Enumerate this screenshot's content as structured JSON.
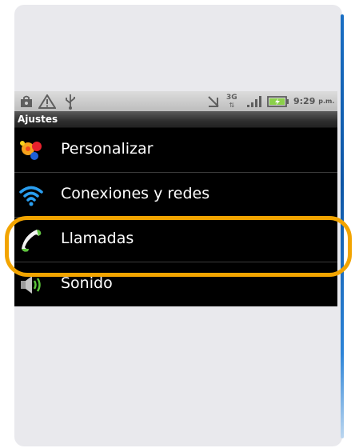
{
  "statusbar": {
    "network_type": "3G",
    "time": "9:29",
    "time_suffix": "p.m.",
    "left_icons": [
      "store-icon",
      "warning-icon",
      "usb-icon"
    ],
    "right_icons": [
      "no-signal-icon",
      "3g-icon",
      "signal-bars-icon",
      "battery-charging-icon"
    ]
  },
  "screen": {
    "title": "Ajustes"
  },
  "settings": {
    "items": [
      {
        "label": "Personalizar",
        "icon": "personalize-icon"
      },
      {
        "label": "Conexiones y redes",
        "icon": "wifi-icon"
      },
      {
        "label": "Llamadas",
        "icon": "phone-icon"
      },
      {
        "label": "Sonido",
        "icon": "speaker-icon"
      }
    ]
  },
  "annotation": {
    "highlighted_item": "Llamadas",
    "color": "#f2a400"
  },
  "colors": {
    "background": "#000000",
    "card": "#e9e9ed",
    "accent_blue": "#1a6fc4"
  }
}
